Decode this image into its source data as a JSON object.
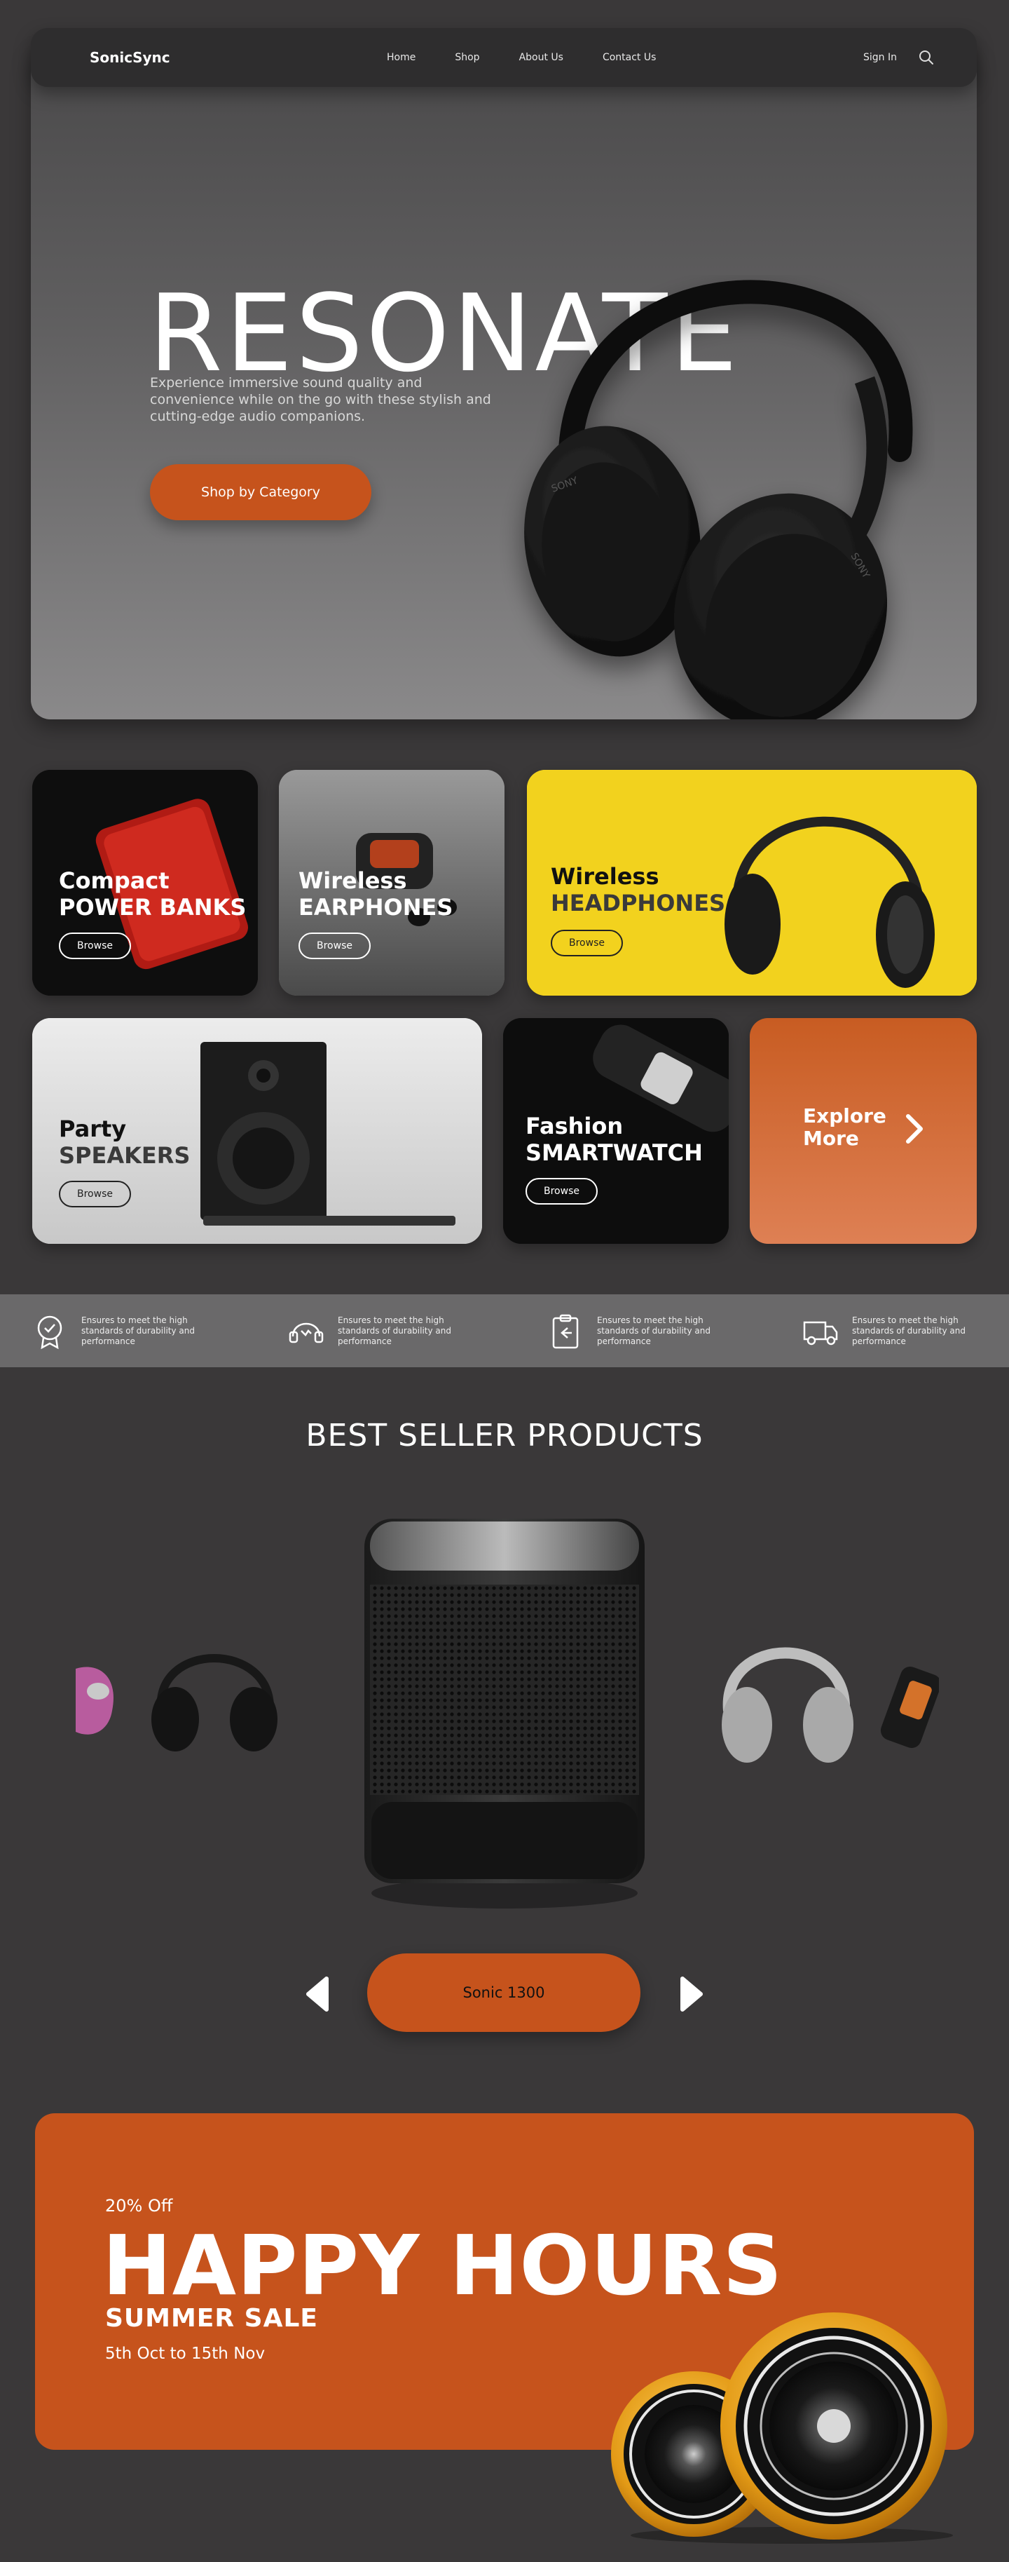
{
  "nav": {
    "logo": "SonicSync",
    "links": [
      "Home",
      "Shop",
      "About Us",
      "Contact Us"
    ],
    "sign_in": "Sign In",
    "search_icon": "search-icon"
  },
  "hero": {
    "title": "RESONATE",
    "subtitle": "Experience immersive sound quality and convenience while on the go with these stylish and cutting-edge audio companions.",
    "cta": "Shop by Category"
  },
  "categories": [
    {
      "line1": "Compact",
      "line2": "POWER BANKS",
      "browse": "Browse"
    },
    {
      "line1": "Wireless",
      "line2": "EARPHONES",
      "browse": "Browse"
    },
    {
      "line1": "Wireless",
      "line2": "HEADPHONES",
      "browse": "Browse"
    },
    {
      "line1": "Party",
      "line2": "SPEAKERS",
      "browse": "Browse"
    },
    {
      "line1": "Fashion",
      "line2": "SMARTWATCH",
      "browse": "Browse"
    }
  ],
  "explore": {
    "line1": "Explore",
    "line2": "More"
  },
  "features": [
    {
      "icon": "award-badge-icon",
      "text": "Ensures to meet the high standards of durability and performance"
    },
    {
      "icon": "headset-support-icon",
      "text": "Ensures to meet the high standards of durability and performance"
    },
    {
      "icon": "clipboard-return-icon",
      "text": "Ensures to meet the high standards of durability and performance"
    },
    {
      "icon": "delivery-truck-icon",
      "text": "Ensures to meet the high standards of durability and performance"
    }
  ],
  "best_seller": {
    "title": "BEST SELLER PRODUCTS",
    "product_name": "Sonic 1300"
  },
  "promo": {
    "discount": "20% Off",
    "title": "HAPPY HOURS",
    "subtitle": "SUMMER SALE",
    "dates": "5th Oct to 15th Nov"
  },
  "colors": {
    "background": "#3a3839",
    "accent": "#c6531c",
    "yellow_card": "#f2d21e",
    "feature_bar": "#6a696a"
  }
}
